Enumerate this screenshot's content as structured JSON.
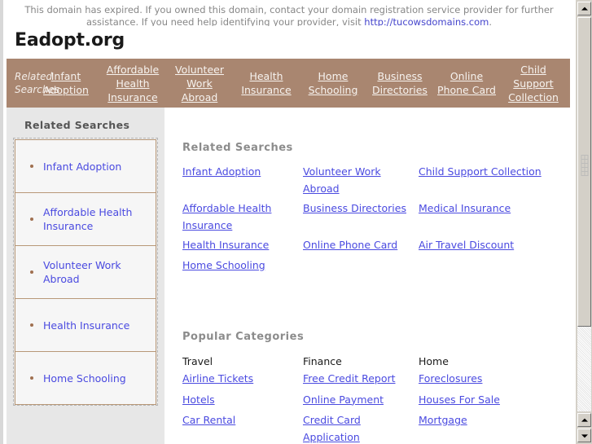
{
  "notice": {
    "text_before": "This domain has expired. If you owned this domain, contact your domain registration service provider for further assistance. If you need help identifying your provider, visit ",
    "link_text": "http://tucowsdomains.com",
    "text_after": "."
  },
  "site": {
    "title": "Eadopt.org"
  },
  "topnav": {
    "label": "Related Searches",
    "links": [
      "Infant Adoption",
      "Affordable Health Insurance",
      "Volunteer Work Abroad",
      "Health Insurance",
      "Home Schooling",
      "Business Directories",
      "Online Phone Card",
      "Child Support Collection"
    ],
    "background_color": "#a98670",
    "link_color": "#f7f3ef"
  },
  "sidebar": {
    "heading": "Related Searches",
    "items": [
      "Infant Adoption",
      "Affordable Health Insurance",
      "Volunteer Work Abroad",
      "Health Insurance",
      "Home Schooling"
    ],
    "background_color": "#e7e7e7",
    "item_border_color": "#b89878",
    "bullet_color": "#a07050"
  },
  "main": {
    "related_searches": {
      "heading": "Related Searches",
      "links": [
        "Infant Adoption",
        "Volunteer Work Abroad",
        "Child Support Collection",
        "Affordable Health Insurance",
        "Business Directories",
        "Medical Insurance",
        "Health Insurance",
        "Online Phone Card",
        "Air Travel Discount",
        "Home Schooling"
      ]
    },
    "popular_categories": {
      "heading": "Popular Categories",
      "columns": [
        {
          "title": "Travel",
          "links": [
            "Airline Tickets",
            "Hotels",
            "Car Rental"
          ]
        },
        {
          "title": "Finance",
          "links": [
            "Free Credit Report",
            "Online Payment",
            "Credit Card Application"
          ]
        },
        {
          "title": "Home",
          "links": [
            "Foreclosures",
            "Houses For Sale",
            "Mortgage"
          ]
        }
      ]
    },
    "link_color": "#4a4ae0"
  },
  "scrollbar": {
    "up_glyph": "▲",
    "down_glyph": "▼"
  }
}
